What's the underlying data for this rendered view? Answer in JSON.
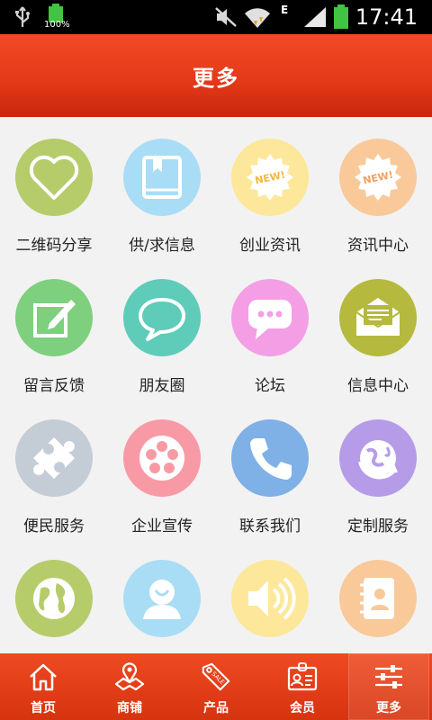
{
  "status_bar": {
    "battery_percent": "100%",
    "network": "E",
    "time": "17:41"
  },
  "header": {
    "title": "更多"
  },
  "grid": [
    {
      "label": "二维码分享",
      "icon": "heart-icon",
      "color": "#b6cc6a"
    },
    {
      "label": "供/求信息",
      "icon": "book-icon",
      "color": "#a9ddf5"
    },
    {
      "label": "创业资讯",
      "icon": "new-badge-icon",
      "color": "#fde79a"
    },
    {
      "label": "资讯中心",
      "icon": "new-badge-icon",
      "color": "#f9c99a"
    },
    {
      "label": "留言反馈",
      "icon": "edit-icon",
      "color": "#7ed07e"
    },
    {
      "label": "朋友圈",
      "icon": "chat-bubble-icon",
      "color": "#5fcbb9"
    },
    {
      "label": "论坛",
      "icon": "message-dots-icon",
      "color": "#f49ee6"
    },
    {
      "label": "信息中心",
      "icon": "mail-icon",
      "color": "#b5b93e"
    },
    {
      "label": "便民服务",
      "icon": "puzzle-icon",
      "color": "#c4cdd6"
    },
    {
      "label": "企业宣传",
      "icon": "film-reel-icon",
      "color": "#f89aa6"
    },
    {
      "label": "联系我们",
      "icon": "phone-icon",
      "color": "#7fb0e6"
    },
    {
      "label": "定制服务",
      "icon": "globe-refresh-icon",
      "color": "#b69ce8"
    },
    {
      "label": "",
      "icon": "world-icon",
      "color": "#b6cc6a"
    },
    {
      "label": "",
      "icon": "user-icon",
      "color": "#a9ddf5"
    },
    {
      "label": "",
      "icon": "speaker-icon",
      "color": "#fde79a"
    },
    {
      "label": "",
      "icon": "contacts-book-icon",
      "color": "#f9c99a"
    }
  ],
  "tabs": [
    {
      "label": "首页",
      "icon": "home-icon",
      "active": false
    },
    {
      "label": "商铺",
      "icon": "map-pin-icon",
      "active": false
    },
    {
      "label": "产品",
      "icon": "sale-tag-icon",
      "active": false
    },
    {
      "label": "会员",
      "icon": "id-card-icon",
      "active": false
    },
    {
      "label": "更多",
      "icon": "sliders-icon",
      "active": true
    }
  ]
}
